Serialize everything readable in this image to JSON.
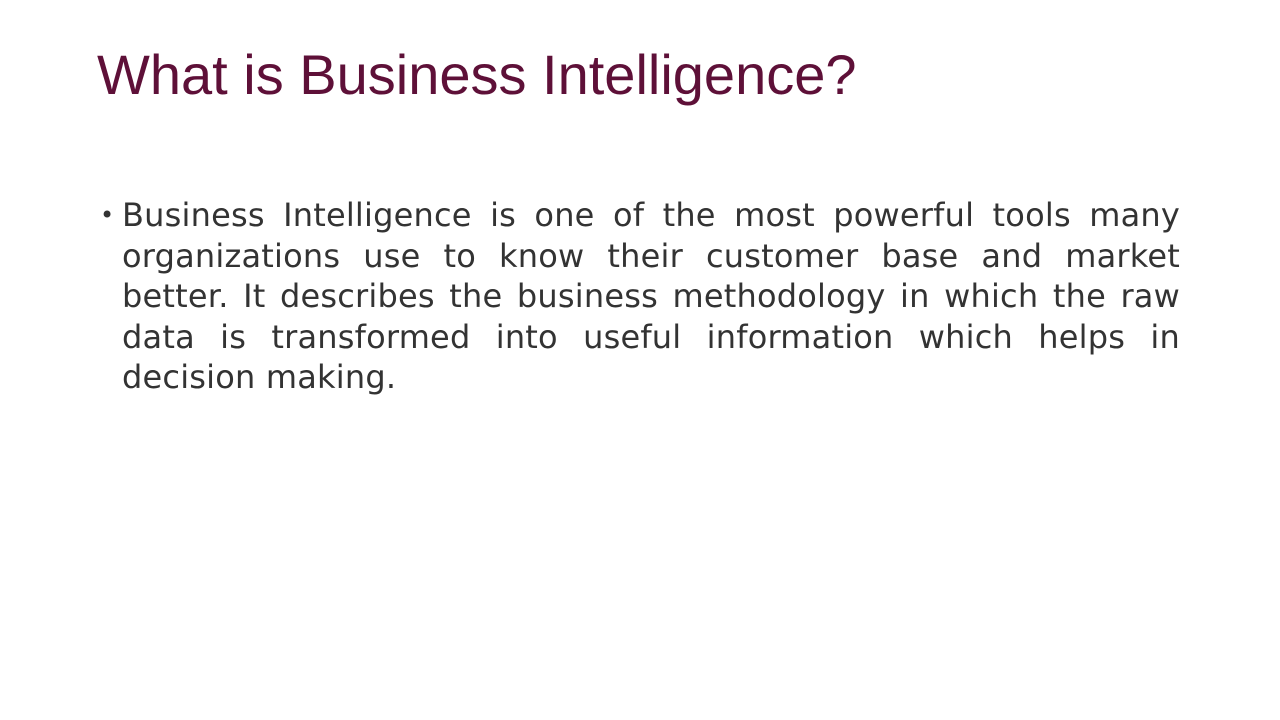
{
  "slide": {
    "title": "What is Business Intelligence?",
    "colors": {
      "title": "#5e1038",
      "body_text": "#333333",
      "background": "#ffffff"
    },
    "bullets": [
      {
        "marker": "•",
        "text": "Business Intelligence is one of the most powerful tools many organizations use to know their customer base and market better. It describes the business methodology in which the raw data is transformed into useful information which helps in decision making."
      }
    ]
  }
}
